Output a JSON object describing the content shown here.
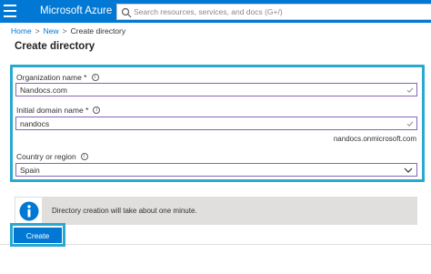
{
  "app": {
    "title": "Microsoft Azure",
    "brand_color": "#0078d4",
    "menu_icon": "hamburger-menu-icon"
  },
  "search": {
    "placeholder": "Search resources, services, and docs (G+/)",
    "icon": "search-icon"
  },
  "breadcrumb": {
    "items": [
      "Home",
      "New",
      "Create directory"
    ],
    "separator": ">"
  },
  "page": {
    "title": "Create directory"
  },
  "form": {
    "organization_name": {
      "label": "Organization name *",
      "value": "Nandocs.com",
      "info_icon": "i"
    },
    "initial_domain_name": {
      "label": "Initial domain name *",
      "value": "nandocs",
      "info_icon": "i",
      "suffix": "nandocs.onmicrosoft.com"
    },
    "country_region": {
      "label": "Country or region",
      "value": "Spain",
      "info_icon": "i"
    },
    "highlight_color": "#29a8d0",
    "field_border_color": "#8764b8"
  },
  "info_banner": {
    "text": "Directory creation will take about one minute.",
    "icon": "info-icon"
  },
  "footer": {
    "create_label": "Create"
  }
}
